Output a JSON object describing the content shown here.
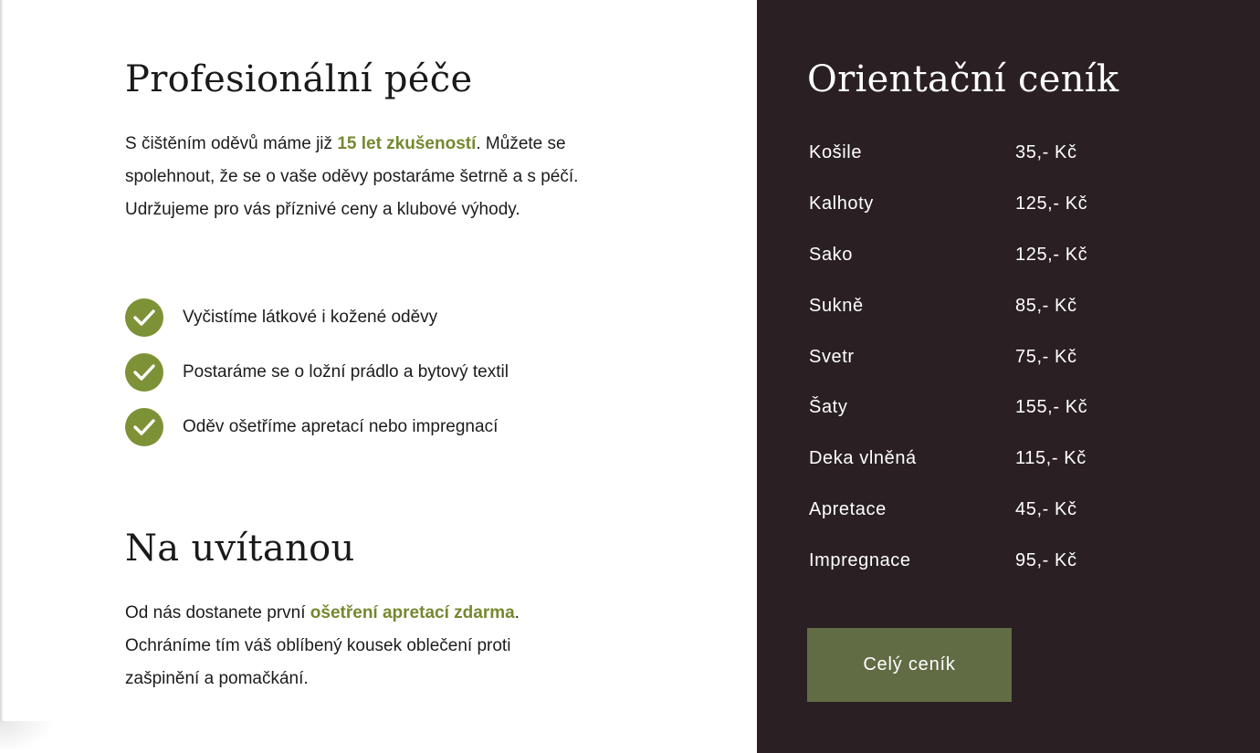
{
  "care": {
    "title": "Profesionální péče",
    "intro_before": "S čištěním oděvů máme již ",
    "intro_highlight": "15 let zkušeností",
    "intro_after": ". Můžete se spolehnout, že se o vaše oděvy postaráme šetrně a s péčí. Udržujeme pro vás příznivé ceny a klubové výhody.",
    "features": [
      "Vyčistíme látkové i kožené oděvy",
      "Postaráme se o ložní prádlo a bytový textil",
      "Oděv ošetříme apretací nebo impregnací"
    ],
    "feature_icon": "check-icon",
    "accent_color": "#7d9236"
  },
  "welcome": {
    "title": "Na uvítanou",
    "text_before": "Od nás dostanete první ",
    "text_highlight": "ošetření apretací zdarma",
    "text_after": ". Ochráníme tím váš oblíbený kousek oblečení proti zašpinění a pomačkání."
  },
  "pricing": {
    "title": "Orientační ceník",
    "background_color": "#2a1f22",
    "items": [
      {
        "name": "Košile",
        "price": "35,- Kč"
      },
      {
        "name": "Kalhoty",
        "price": "125,- Kč"
      },
      {
        "name": "Sako",
        "price": "125,- Kč"
      },
      {
        "name": "Sukně",
        "price": "85,- Kč"
      },
      {
        "name": "Svetr",
        "price": "75,- Kč"
      },
      {
        "name": "Šaty",
        "price": "155,- Kč"
      },
      {
        "name": "Deka vlněná",
        "price": "115,- Kč"
      },
      {
        "name": "Apretace",
        "price": "45,- Kč"
      },
      {
        "name": "Impregnace",
        "price": "95,- Kč"
      }
    ],
    "button_label": "Celý ceník",
    "button_color": "#616c45"
  }
}
